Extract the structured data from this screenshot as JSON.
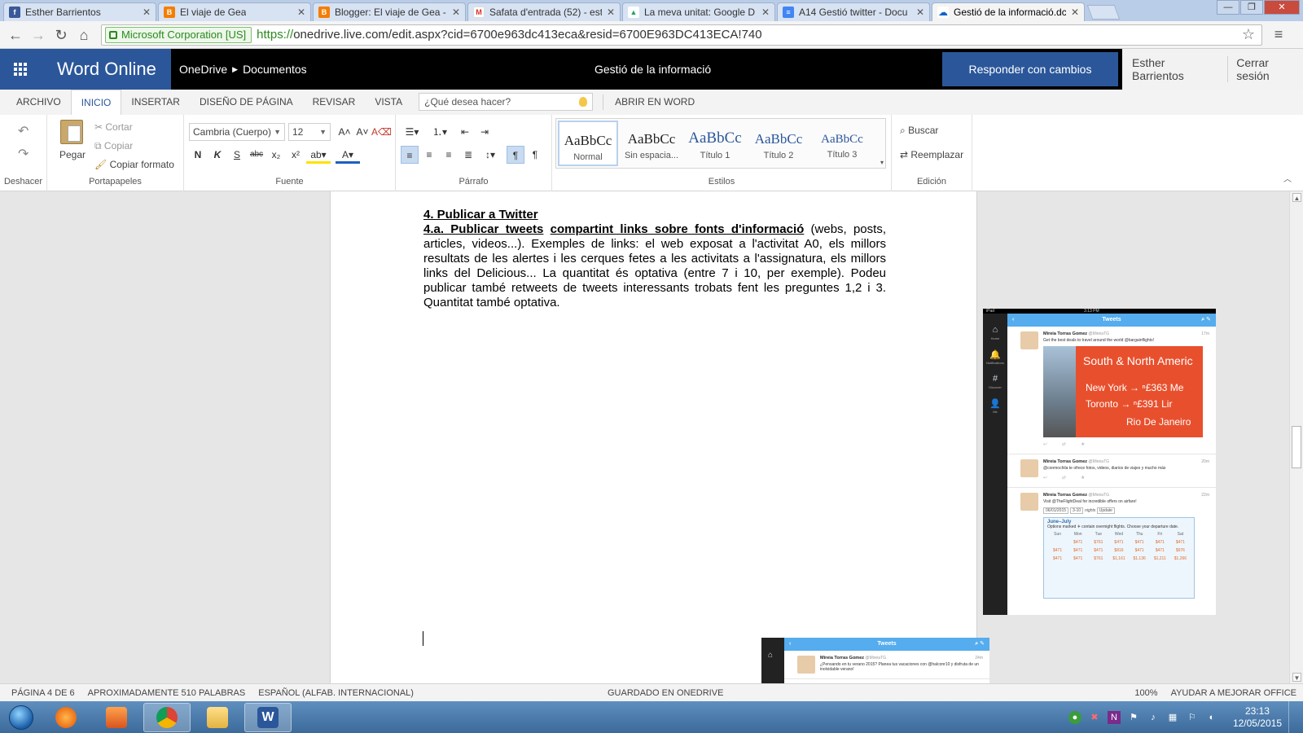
{
  "browser": {
    "tabs": [
      {
        "title": "Esther Barrientos",
        "favicon": "facebook-icon",
        "color": "#3b5998",
        "glyph": "f"
      },
      {
        "title": "El viaje de Gea",
        "favicon": "blogger-icon",
        "color": "#f57d00",
        "glyph": "B"
      },
      {
        "title": "Blogger: El viaje de Gea - ",
        "favicon": "blogger-icon",
        "color": "#f57d00",
        "glyph": "B"
      },
      {
        "title": "Safata d'entrada (52) - est",
        "favicon": "gmail-icon",
        "color": "#d93025",
        "glyph": "M"
      },
      {
        "title": "La meva unitat: Google D",
        "favicon": "google-drive-icon",
        "color": "#1fa463",
        "glyph": "▲"
      },
      {
        "title": "A14 Gestió twitter - Docu",
        "favicon": "google-docs-icon",
        "color": "#4285f4",
        "glyph": "≡"
      },
      {
        "title": "Gestió de la informació.dc",
        "favicon": "onedrive-icon",
        "color": "#0a64c8",
        "glyph": "☁"
      }
    ],
    "ev_label": "Microsoft Corporation [US]",
    "url_scheme": "https://",
    "url_rest": "onedrive.live.com/edit.aspx?cid=6700e963dc413eca&resid=6700E963DC413ECA!740"
  },
  "app": {
    "brand": "Word Online",
    "crumb1": "OneDrive",
    "crumb2": "Documentos",
    "doc_title": "Gestió de la informació",
    "reply_button": "Responder con cambios",
    "user_name": "Esther Barrientos",
    "sign_out": "Cerrar sesión"
  },
  "ribbon_tabs": {
    "archivo": "ARCHIVO",
    "inicio": "INICIO",
    "insertar": "INSERTAR",
    "diseno": "DISEÑO DE PÁGINA",
    "revisar": "REVISAR",
    "vista": "VISTA",
    "tellme_placeholder": "¿Qué desea hacer?",
    "open_in_word": "ABRIR EN WORD"
  },
  "ribbon": {
    "undo_group": "Deshacer",
    "clipboard_group": "Portapapeles",
    "paste": "Pegar",
    "cut": "Cortar",
    "copy": "Copiar",
    "format_painter": "Copiar formato",
    "font_group": "Fuente",
    "font_name": "Cambria (Cuerpo)",
    "font_size": "12",
    "bold": "N",
    "italic": "K",
    "underline": "S",
    "strike": "abc",
    "subscript": "x₂",
    "superscript": "x²",
    "paragraph_group": "Párrafo",
    "styles_group": "Estilos",
    "style_sample": "AaBbCc",
    "styles": [
      "Normal",
      "Sin espacia...",
      "Título 1",
      "Título 2",
      "Título 3"
    ],
    "editing_group": "Edición",
    "find": "Buscar",
    "replace": "Reemplazar"
  },
  "document": {
    "heading": "4. Publicar a Twitter",
    "p1_a": "4.a. Publicar tweets",
    "p1_b": "compartint links sobre fonts d'informació",
    "p1_c": " (webs, posts, articles, videos...). Exemples de links: el web exposat a l'activitat A0, els millors resultats de les alertes i les cerques fetes a les activitats a l'assignatura, els millors links del Delicious... La quantitat és optativa (entre 7 i 10, per exemple). Podeu publicar també retweets de tweets interessants trobats fent les preguntes 1,2 i 3. Quantitat també optativa."
  },
  "screenshot1": {
    "status_left": "iPad",
    "status_time": "3:13 PM",
    "header": "Tweets",
    "nav": [
      "Home",
      "Notifications",
      "Discover",
      "Me"
    ],
    "tweets": [
      {
        "name": "Mireia Torras Gomez",
        "handle": "@MireiaTG",
        "time": "17m",
        "text": "Get the best deals to travel around the world @bargainflights!"
      },
      {
        "name": "Mireia Torras Gomez",
        "handle": "@MireiaTG",
        "time": "20m",
        "text": "@conmochila te ofrece fotos, videos, diarios de viajes y mucho más"
      },
      {
        "name": "Mireia Torras Gomez",
        "handle": "@MireiaTG",
        "time": "22m",
        "text": "Visit @TheFlightDeal for incredible offers on airfare!"
      }
    ],
    "promo": {
      "title": "South & North Americ",
      "row1": "New York → ⁿ£363  Me",
      "row2": "Toronto   → ⁿ£391  Lir",
      "row3": "Rio De Janeiro"
    },
    "form": {
      "date": "06/01/2015",
      "nights": "3-10",
      "nights_label": "nights",
      "update": "Update"
    },
    "calendar": {
      "title": "June–July",
      "subtitle": "Options marked ✈ contain overnight flights. Choose your departure date.",
      "days": [
        "Sun",
        "Mon",
        "Tue",
        "Wed",
        "Thu",
        "Fri",
        "Sat"
      ],
      "row1": [
        "",
        "$471",
        "$761",
        "$471",
        "$471",
        "$471",
        "$471"
      ],
      "row2": [
        "$471",
        "$471",
        "$471",
        "$816",
        "$471",
        "$471",
        "$976"
      ],
      "row3": [
        "$471",
        "$471",
        "$761",
        "$1,161",
        "$1,136",
        "$1,211",
        "$1,266"
      ]
    }
  },
  "screenshot2": {
    "header": "Tweets",
    "name": "Mireia Torras Gomez",
    "handle": "@MireiaTG",
    "time": "24m",
    "text": "¿Pensando en tu verano 2015? Planea tus vacaciones con @halconr10 y disfruta de un inolvidable verano!"
  },
  "statusbar": {
    "page": "PÁGINA 4 DE 6",
    "words": "APROXIMADAMENTE 510 PALABRAS",
    "language": "ESPAÑOL (ALFAB. INTERNACIONAL)",
    "saved": "GUARDADO EN ONEDRIVE",
    "zoom": "100%",
    "help": "AYUDAR A MEJORAR OFFICE"
  },
  "taskbar": {
    "time": "23:13",
    "date": "12/05/2015"
  }
}
